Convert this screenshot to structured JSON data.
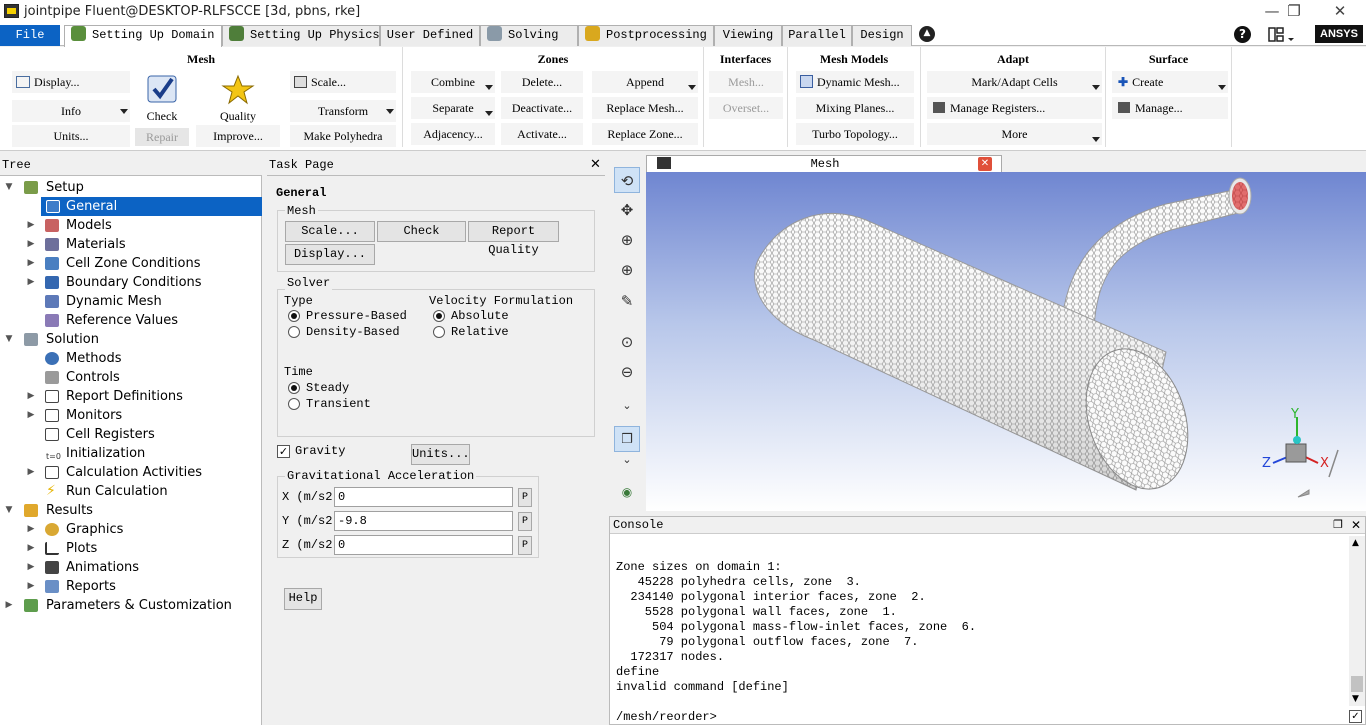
{
  "window": {
    "title": "jointpipe Fluent@DESKTOP-RLFSCCE  [3d, pbns, rke]",
    "minimize": "—",
    "maximize": "❐",
    "close": "✕"
  },
  "menu": {
    "tabs": [
      "File",
      "Setting Up Domain",
      "Setting Up Physics",
      "User Defined",
      "Solving",
      "Postprocessing",
      "Viewing",
      "Parallel",
      "Design"
    ],
    "help": "?",
    "logo": "ANSYS"
  },
  "ribbon": {
    "mesh": {
      "title": "Mesh",
      "display": "Display...",
      "info": "Info",
      "units": "Units...",
      "check": "Check",
      "repair": "Repair",
      "quality": "Quality",
      "improve": "Improve...",
      "scale": "Scale...",
      "transform": "Transform",
      "make_polyhedra": "Make Polyhedra"
    },
    "zones": {
      "title": "Zones",
      "combine": "Combine",
      "separate": "Separate",
      "adjacency": "Adjacency...",
      "delete": "Delete...",
      "deactivate": "Deactivate...",
      "activate": "Activate...",
      "append": "Append",
      "replace_mesh": "Replace Mesh...",
      "replace_zone": "Replace Zone..."
    },
    "interfaces": {
      "title": "Interfaces",
      "mesh": "Mesh...",
      "overset": "Overset..."
    },
    "mesh_models": {
      "title": "Mesh Models",
      "dynamic": "Dynamic Mesh...",
      "mixing": "Mixing Planes...",
      "turbo": "Turbo Topology..."
    },
    "adapt": {
      "title": "Adapt",
      "mark": "Mark/Adapt Cells",
      "manage": "Manage Registers...",
      "more": "More"
    },
    "surface": {
      "title": "Surface",
      "create": "Create",
      "manage": "Manage..."
    }
  },
  "tree": {
    "header": "Tree",
    "items": [
      {
        "label": "Setup"
      },
      {
        "label": "General"
      },
      {
        "label": "Models"
      },
      {
        "label": "Materials"
      },
      {
        "label": "Cell Zone Conditions"
      },
      {
        "label": "Boundary Conditions"
      },
      {
        "label": "Dynamic Mesh"
      },
      {
        "label": "Reference Values"
      },
      {
        "label": "Solution"
      },
      {
        "label": "Methods"
      },
      {
        "label": "Controls"
      },
      {
        "label": "Report Definitions"
      },
      {
        "label": "Monitors"
      },
      {
        "label": "Cell Registers"
      },
      {
        "label": "Initialization"
      },
      {
        "label": "Calculation Activities"
      },
      {
        "label": "Run Calculation"
      },
      {
        "label": "Results"
      },
      {
        "label": "Graphics"
      },
      {
        "label": "Plots"
      },
      {
        "label": "Animations"
      },
      {
        "label": "Reports"
      },
      {
        "label": "Parameters & Customization"
      }
    ],
    "init_sub": "t=0"
  },
  "task": {
    "header": "Task Page",
    "close": "✕",
    "title": "General",
    "mesh_label": "Mesh",
    "scale": "Scale...",
    "check": "Check",
    "report_quality": "Report Quality",
    "display": "Display...",
    "solver_label": "Solver",
    "type_label": "Type",
    "pressure": "Pressure-Based",
    "density": "Density-Based",
    "velocity_label": "Velocity Formulation",
    "absolute": "Absolute",
    "relative": "Relative",
    "time_label": "Time",
    "steady": "Steady",
    "transient": "Transient",
    "gravity": "Gravity",
    "units": "Units...",
    "grav_label": "Gravitational Acceleration",
    "x_label": "X (m/s2)",
    "y_label": "Y (m/s2)",
    "z_label": "Z (m/s2)",
    "x_val": "0",
    "y_val": "-9.8",
    "z_val": "0",
    "p": "P",
    "help": "Help"
  },
  "graphics": {
    "tab": "Mesh",
    "close": "✕",
    "axes": {
      "x": "X",
      "y": "Y",
      "z": "Z"
    }
  },
  "console": {
    "title": "Console",
    "lines": [
      "Zone sizes on domain 1:",
      "   45228 polyhedra cells, zone  3.",
      "  234140 polygonal interior faces, zone  2.",
      "    5528 polygonal wall faces, zone  1.",
      "     504 polygonal mass-flow-inlet faces, zone  6.",
      "      79 polygonal outflow faces, zone  7.",
      "  172317 nodes.",
      "define",
      "invalid command [define]",
      "",
      "/mesh/reorder>"
    ]
  }
}
